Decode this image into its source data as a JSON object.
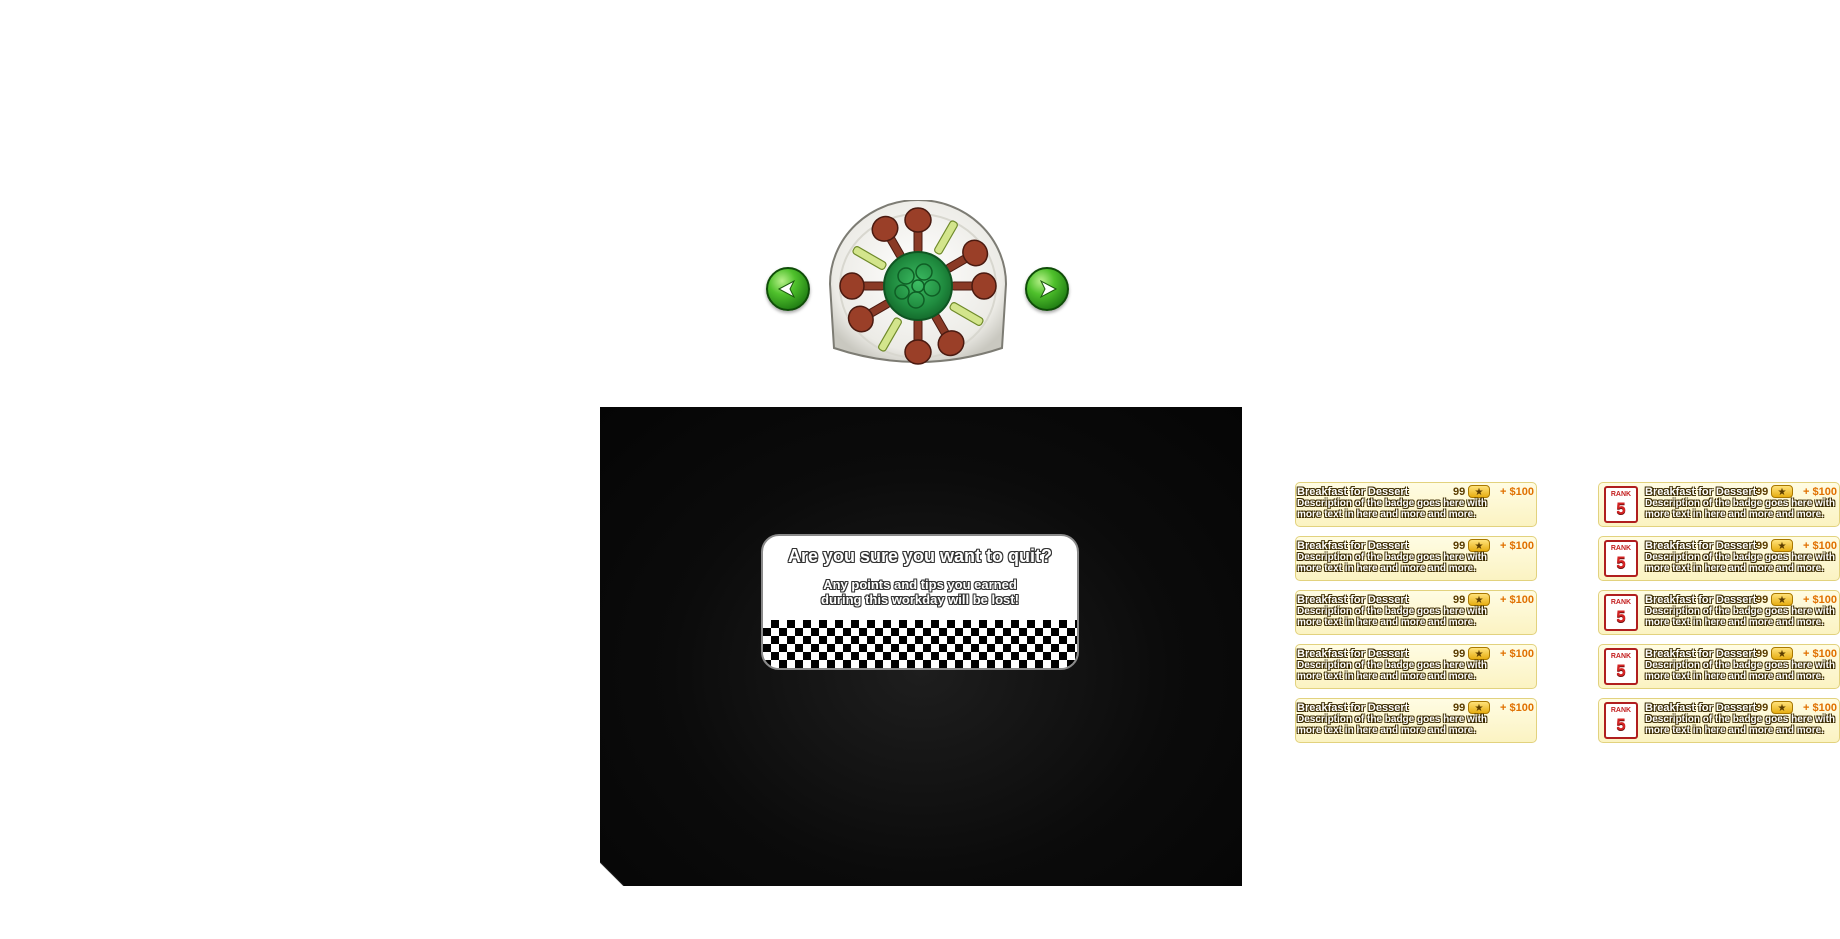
{
  "colors": {
    "panel": "#0b0b0b",
    "arrow_green": "#3aa51f",
    "badge_bg": "#fdf6cc",
    "badge_bonus": "#e07000",
    "rank_red": "#c42020"
  },
  "nav": {
    "left_icon": "arrow-left-icon",
    "right_icon": "arrow-right-icon"
  },
  "plate": {
    "icon": "chicken-wings-plate-icon"
  },
  "quit_dialog": {
    "title": "Are you sure you want to quit?",
    "line1": "Any points and tips you earned",
    "line2": "during this workday will be lost!"
  },
  "badges": {
    "left": [
      {
        "title": "Breakfast for Dessert",
        "points": "99",
        "bonus": "+ $100",
        "desc1": "Description of the badge goes here with",
        "desc2": "more text in here and more and more."
      },
      {
        "title": "Breakfast for Dessert",
        "points": "99",
        "bonus": "+ $100",
        "desc1": "Description of the badge goes here with",
        "desc2": "more text in here and more and more."
      },
      {
        "title": "Breakfast for Dessert",
        "points": "99",
        "bonus": "+ $100",
        "desc1": "Description of the badge goes here with",
        "desc2": "more text in here and more and more."
      },
      {
        "title": "Breakfast for Dessert",
        "points": "99",
        "bonus": "+ $100",
        "desc1": "Description of the badge goes here with",
        "desc2": "more text in here and more and more."
      },
      {
        "title": "Breakfast for Dessert",
        "points": "99",
        "bonus": "+ $100",
        "desc1": "Description of the badge goes here with",
        "desc2": "more text in here and more and more."
      }
    ],
    "right": [
      {
        "rank_label": "RANK",
        "rank": "5",
        "title": "Breakfast for Dessert",
        "points": "99",
        "bonus": "+ $100",
        "desc1": "Description of the badge goes here with",
        "desc2": "more text in here and more and more."
      },
      {
        "rank_label": "RANK",
        "rank": "5",
        "title": "Breakfast for Dessert",
        "points": "99",
        "bonus": "+ $100",
        "desc1": "Description of the badge goes here with",
        "desc2": "more text in here and more and more."
      },
      {
        "rank_label": "RANK",
        "rank": "5",
        "title": "Breakfast for Dessert",
        "points": "99",
        "bonus": "+ $100",
        "desc1": "Description of the badge goes here with",
        "desc2": "more text in here and more and more."
      },
      {
        "rank_label": "RANK",
        "rank": "5",
        "title": "Breakfast for Dessert",
        "points": "99",
        "bonus": "+ $100",
        "desc1": "Description of the badge goes here with",
        "desc2": "more text in here and more and more."
      },
      {
        "rank_label": "RANK",
        "rank": "5",
        "title": "Breakfast for Dessert",
        "points": "99",
        "bonus": "+ $100",
        "desc1": "Description of the badge goes here with",
        "desc2": "more text in here and more and more."
      }
    ]
  }
}
